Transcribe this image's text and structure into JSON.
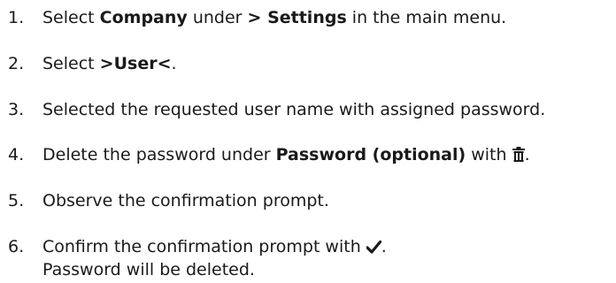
{
  "steps": [
    {
      "number": "1.",
      "parts": [
        "Select ",
        "Company",
        " under ",
        "> Settings",
        " in the main menu."
      ]
    },
    {
      "number": "2.",
      "parts": [
        "Select ",
        ">User<",
        "."
      ]
    },
    {
      "number": "3.",
      "text": "Selected the requested user name with assigned password."
    },
    {
      "number": "4.",
      "parts": [
        "Delete the password under ",
        "Password (optional)",
        " with ",
        "."
      ],
      "icon": "trash-icon"
    },
    {
      "number": "5.",
      "text": "Observe the confirmation prompt."
    },
    {
      "number": "6.",
      "parts": [
        "Confirm the confirmation prompt with ",
        "."
      ],
      "icon": "checkmark-icon",
      "line2": "Password will be deleted."
    }
  ]
}
